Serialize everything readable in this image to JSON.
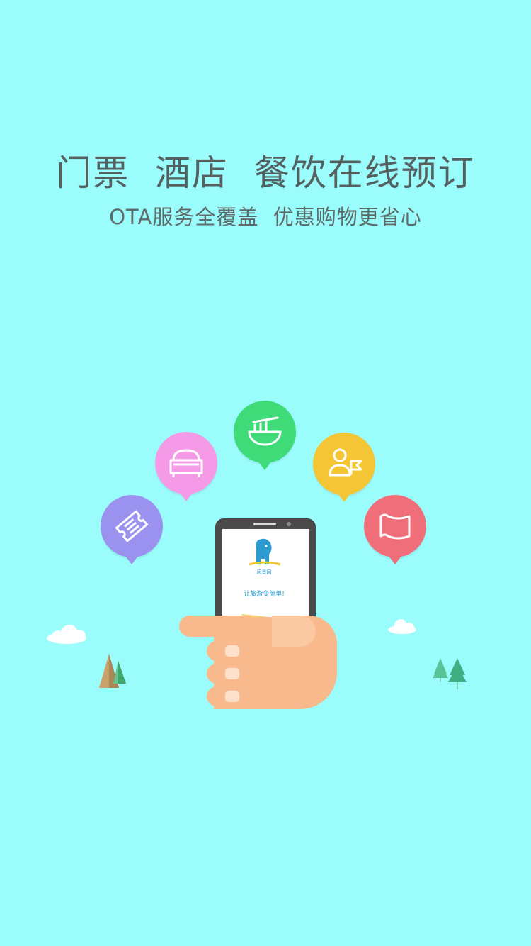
{
  "headline": "门票  酒店  餐饮在线预订",
  "subheadline": "OTA服务全覆盖  优惠购物更省心",
  "phone": {
    "brand": "风景网",
    "tagline": "让旅游变简单!"
  },
  "features": [
    {
      "name": "ticket",
      "icon": "ticket-icon",
      "color": "#9A92EE"
    },
    {
      "name": "hotel",
      "icon": "bed-icon",
      "color": "#F59AE6"
    },
    {
      "name": "dining",
      "icon": "noodle-bowl-icon",
      "color": "#3EDB78"
    },
    {
      "name": "guide",
      "icon": "guide-person-flag-icon",
      "color": "#F4C535"
    },
    {
      "name": "map",
      "icon": "map-scroll-icon",
      "color": "#F06E79"
    }
  ],
  "colors": {
    "background": "#9BFCFC",
    "text": "#556160",
    "phone_body": "#4a4a4a",
    "hand": "#F8B98C"
  }
}
